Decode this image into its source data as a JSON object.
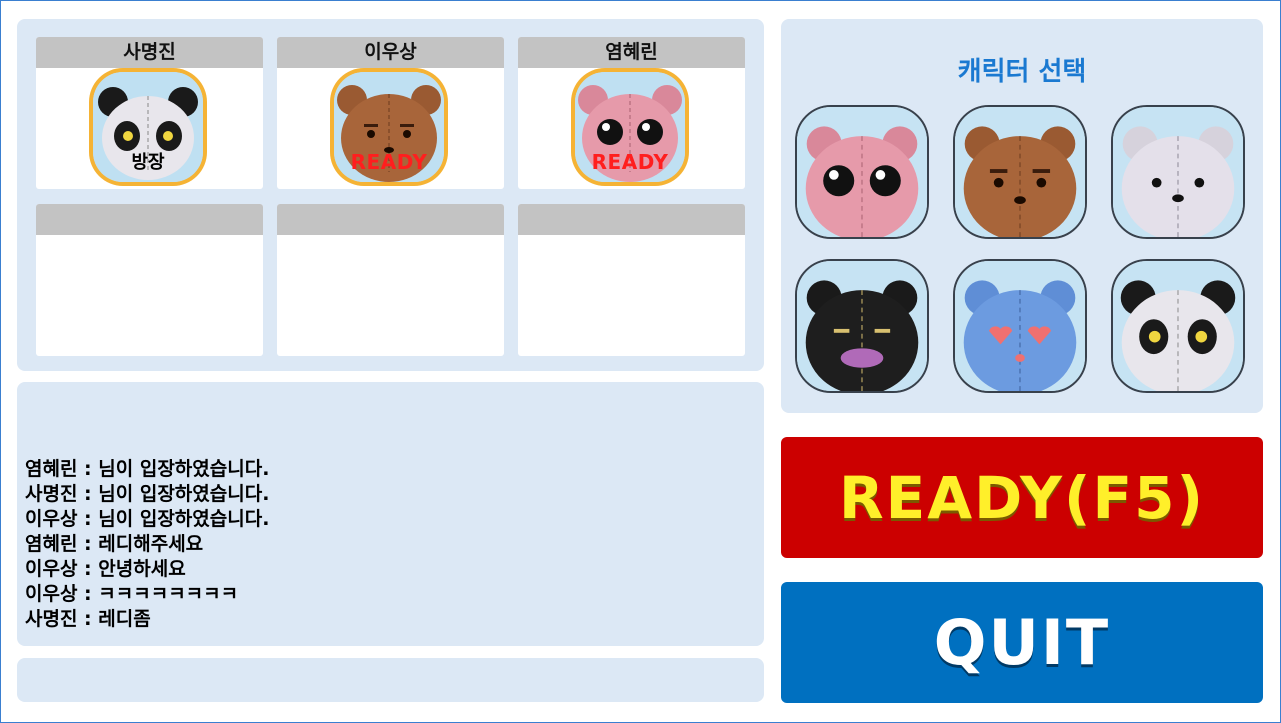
{
  "slots": [
    {
      "name": "사명진",
      "character": "panda",
      "status": "방장"
    },
    {
      "name": "이우상",
      "character": "brown",
      "status": "READY"
    },
    {
      "name": "염혜린",
      "character": "pink",
      "status": "READY"
    },
    {
      "name": "",
      "character": "",
      "status": ""
    },
    {
      "name": "",
      "character": "",
      "status": ""
    },
    {
      "name": "",
      "character": "",
      "status": ""
    }
  ],
  "chat": [
    "염혜린 : 님이 입장하였습니다.",
    "사명진 : 님이 입장하였습니다.",
    "이우상 : 님이 입장하였습니다.",
    "염혜린 : 레디해주세요",
    "이우상 : 안녕하세요",
    "이우상 : ㅋㅋㅋㅋㅋㅋㅋㅋ",
    "사명진 : 레디좀"
  ],
  "character_select": {
    "title": "캐릭터 선택",
    "characters": [
      "pink-bear",
      "brown-bear",
      "white-bear",
      "black-bear",
      "blue-bear",
      "panda"
    ]
  },
  "buttons": {
    "ready_label": "READY(F5)",
    "quit_label": "QUIT"
  },
  "colors": {
    "panel": "#dce8f5",
    "ready_bg": "#cc0000",
    "ready_text": "#ffef2a",
    "quit_bg": "#0070c0",
    "title_blue": "#1a79d1",
    "ready_overlay": "#ff1e1e"
  }
}
